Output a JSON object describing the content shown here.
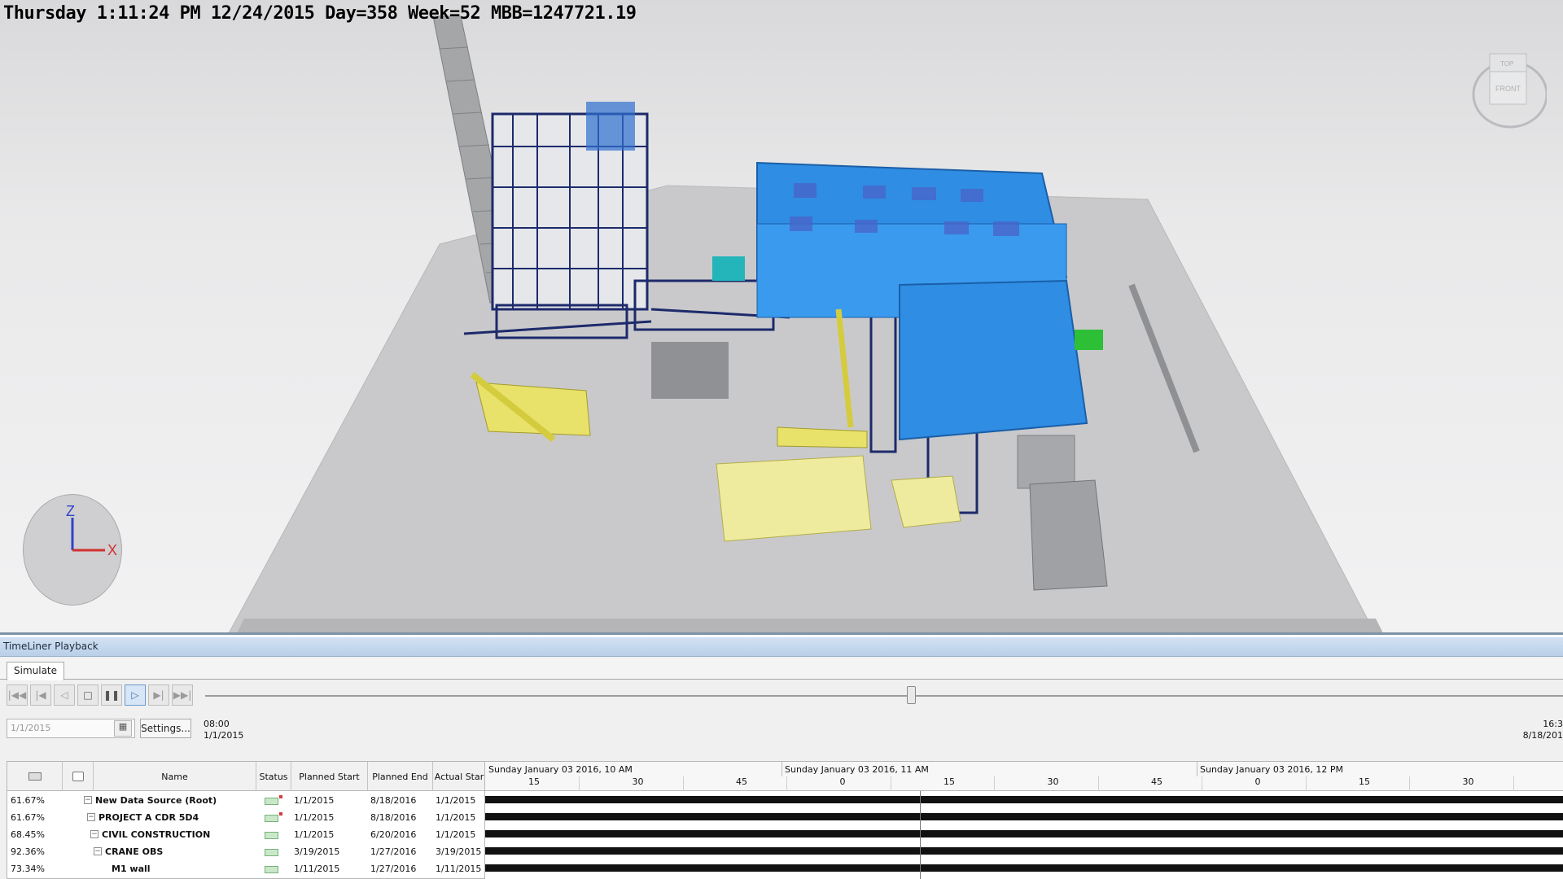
{
  "viewport": {
    "hud_text": "Thursday 1:11:24 PM 12/24/2015 Day=358 Week=52 MBB=1247721.19",
    "axis_labels": {
      "z": "Z",
      "x": "X"
    },
    "viewcube": {
      "top_label": "TOP",
      "front_label": "FRONT"
    }
  },
  "timeliner": {
    "title": "TimeLiner Playback",
    "tabs": [
      {
        "label": "Simulate",
        "active": true
      }
    ],
    "playback_buttons": [
      {
        "icon": "skip-to-start-icon"
      },
      {
        "icon": "step-back-icon"
      },
      {
        "icon": "reverse-play-icon"
      },
      {
        "icon": "stop-icon"
      },
      {
        "icon": "pause-icon"
      },
      {
        "icon": "play-icon",
        "active": true
      },
      {
        "icon": "step-forward-icon"
      },
      {
        "icon": "skip-to-end-icon"
      }
    ],
    "playback_position": 0.52,
    "date_input_value": "1/1/2015",
    "settings_label": "Settings...",
    "start_time": "08:00",
    "start_date": "1/1/2015",
    "end_time": "16:3",
    "end_date": "8/18/201",
    "grid": {
      "columns": [
        "",
        "",
        "Name",
        "Status",
        "Planned Start",
        "Planned End",
        "Actual Star"
      ],
      "rows": [
        {
          "pct": "61.67%",
          "name": "New Data Source (Root)",
          "planned_start": "1/1/2015",
          "planned_end": "8/18/2016",
          "actual_start": "1/1/2015",
          "expander": "−",
          "flag": true
        },
        {
          "pct": "61.67%",
          "name": "PROJECT A CDR 5D4",
          "planned_start": "1/1/2015",
          "planned_end": "8/18/2016",
          "actual_start": "1/1/2015",
          "expander": "−",
          "flag": true
        },
        {
          "pct": "68.45%",
          "name": "CIVIL CONSTRUCTION",
          "planned_start": "1/1/2015",
          "planned_end": "6/20/2016",
          "actual_start": "1/1/2015",
          "expander": "−",
          "flag": false
        },
        {
          "pct": "92.36%",
          "name": "CRANE OBS",
          "planned_start": "3/19/2015",
          "planned_end": "1/27/2016",
          "actual_start": "3/19/2015",
          "expander": "−",
          "flag": false
        },
        {
          "pct": "73.34%",
          "name": "M1 wall",
          "planned_start": "1/11/2015",
          "planned_end": "1/27/2016",
          "actual_start": "1/11/2015",
          "expander": "",
          "flag": false
        }
      ]
    },
    "gantt": {
      "headers": [
        "Sunday January 03 2016, 10 AM",
        "Sunday January 03 2016, 11 AM",
        "Sunday January 03 2016, 12 PM"
      ],
      "ticks": [
        "15",
        "30",
        "45",
        "0",
        "15",
        "30",
        "45",
        "0",
        "15",
        "30",
        "4"
      ]
    }
  }
}
